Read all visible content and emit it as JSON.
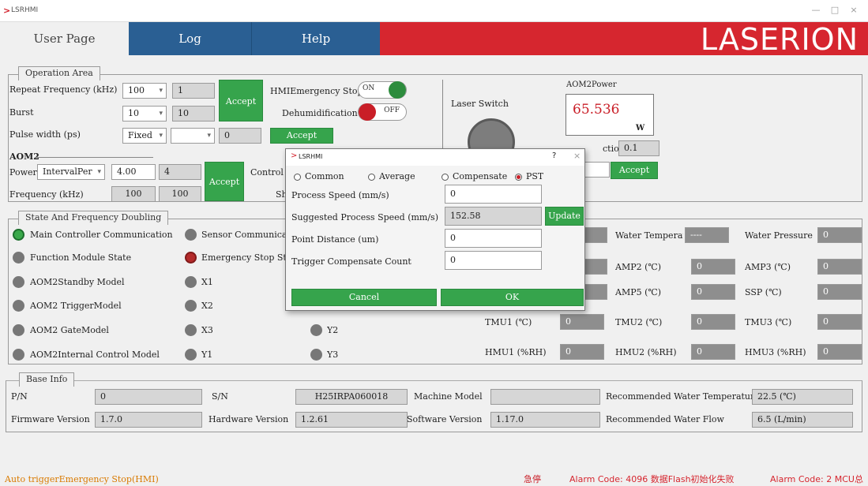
{
  "window": {
    "title": "LSRHMI",
    "icon": "laser-logo-icon",
    "controls": [
      "minimize-icon",
      "maximize-icon",
      "close-icon"
    ]
  },
  "nav": {
    "tabs": [
      "User Page",
      "Log",
      "Help"
    ],
    "brand": "LASERION"
  },
  "operation": {
    "title": "Operation Area",
    "repeat_label": "Repeat Frequency (kHz)",
    "repeat_select": "100",
    "repeat_value": "1",
    "burst_label": "Burst",
    "burst_select": "10",
    "burst_value": "10",
    "pulse_label": "Pulse width (ps)",
    "pulse_select": "Fixed",
    "pulse_select2": "",
    "pulse_value": "0",
    "accept": "Accept",
    "hmi_estop_label": "HMIEmergency Stop",
    "hmi_estop_state": "ON",
    "dehumid_label": "Dehumidification",
    "dehumid_state": "OFF",
    "aom2_label": "AOM2",
    "power_label": "Power",
    "power_select": "IntervalPer",
    "power_value": "4.00",
    "power_readback": "4",
    "control_label": "Control",
    "sh_label": "Sh",
    "freq_label": "Frequency (kHz)",
    "freq_value": "100",
    "freq_readback": "100",
    "laser_switch_label": "Laser Switch",
    "aom2power_label": "AOM2Power",
    "aom2power_value": "65.536",
    "aom2power_unit": "W",
    "correction_label": "ctio",
    "correction_value": "0.1"
  },
  "state": {
    "title": "State And Frequency Doubling",
    "leds": [
      {
        "label": "Main Controller Communication",
        "state": "green"
      },
      {
        "label": "Sensor Communicat",
        "state": "gray"
      },
      {
        "label": "Function Module State",
        "state": "gray"
      },
      {
        "label": "Emergency Stop St",
        "state": "red"
      },
      {
        "label": "AOM2Standby Model",
        "state": "gray"
      },
      {
        "label": "X1",
        "state": "gray"
      },
      {
        "label": "AOM2 TriggerModel",
        "state": "gray"
      },
      {
        "label": "X2",
        "state": "gray"
      },
      {
        "label": "AOM2 GateModel",
        "state": "gray"
      },
      {
        "label": "X3",
        "state": "gray"
      },
      {
        "label": "Y2",
        "state": "gray"
      },
      {
        "label": "AOM2Internal Control Model",
        "state": "gray"
      },
      {
        "label": "Y1",
        "state": "gray"
      },
      {
        "label": "Y3",
        "state": "gray"
      }
    ]
  },
  "sensors": [
    {
      "label": "Water Temperat",
      "value": "----"
    },
    {
      "label": "Water Pressure",
      "value": "0"
    },
    {
      "label": "AMP2 (℃)",
      "value": "0"
    },
    {
      "label": "AMP3 (℃)",
      "value": "0"
    },
    {
      "label": "AMP5 (℃)",
      "value": "0"
    },
    {
      "label": "SSP (℃)",
      "value": "0"
    },
    {
      "label": "TMU1 (℃)",
      "value": "0"
    },
    {
      "label": "TMU2 (℃)",
      "value": "0"
    },
    {
      "label": "TMU3 (℃)",
      "value": "0"
    },
    {
      "label": "HMU1 (%RH)",
      "value": "0"
    },
    {
      "label": "HMU2 (%RH)",
      "value": "0"
    },
    {
      "label": "HMU3 (%RH)",
      "value": "0"
    }
  ],
  "base": {
    "title": "Base Info",
    "pn_label": "P/N",
    "pn_value": "0",
    "sn_label": "S/N",
    "sn_value": "H25IRPA060018",
    "machine_label": "Machine Model",
    "machine_value": "",
    "rec_temp_label": "Recommended Water Temperature",
    "rec_temp_value": "22.5 (℃)",
    "fw_label": "Firmware Version",
    "fw_value": "1.7.0",
    "hw_label": "Hardware Version",
    "hw_value": "1.2.61",
    "sw_label": "Software Version",
    "sw_value": "1.17.0",
    "rec_flow_label": "Recommended Water Flow",
    "rec_flow_value": "6.5 (L/min)"
  },
  "dialog": {
    "title": "LSRHMI",
    "help": "?",
    "close": "×",
    "modes": [
      "Common",
      "Average",
      "Compensate",
      "PST"
    ],
    "selected_mode": "PST",
    "process_speed_label": "Process Speed (mm/s)",
    "process_speed_value": "0",
    "suggested_label": "Suggested Process Speed (mm/s)",
    "suggested_value": "152.58",
    "update": "Update",
    "point_label": "Point Distance (um)",
    "point_value": "0",
    "trigger_label": "Trigger Compensate Count",
    "trigger_value": "0",
    "cancel": "Cancel",
    "ok": "OK"
  },
  "status": {
    "left": "Auto triggerEmergency Stop(HMI)",
    "estop": "急停",
    "alarm1": "Alarm Code: 4096 数据Flash初始化失败",
    "alarm2": "Alarm Code: 2 MCU总"
  },
  "colors": {
    "red": "#d6262f",
    "blue": "#2a5f93",
    "green": "#36a44c"
  }
}
